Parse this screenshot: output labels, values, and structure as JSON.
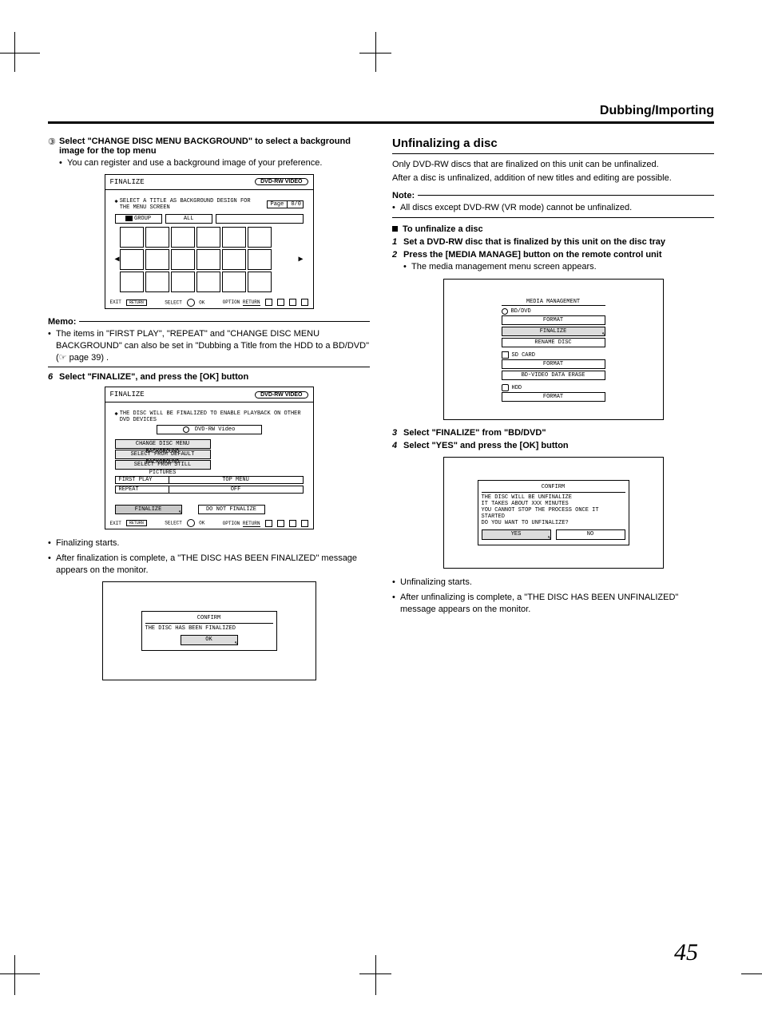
{
  "header": {
    "section": "Dubbing/Importing"
  },
  "page_number": "45",
  "left": {
    "step3": {
      "marker": "③",
      "title": "Select \"CHANGE DISC MENU BACKGROUND\" to select a background image for the top menu",
      "bullet": "You can register and use a background image of your preference."
    },
    "fig1": {
      "title": "FINALIZE",
      "badge": "DVD-RW VIDEO",
      "promptStar": "✱",
      "prompt": "SELECT A TITLE AS BACKGROUND DESIGN FOR THE MENU SCREEN",
      "page_label": "Page",
      "page_val": "0/0",
      "group": "GROUP",
      "all": "ALL",
      "foot_exit": "EXIT",
      "foot_back": "RETURN",
      "foot_select": "SELECT",
      "foot_ok": "OK",
      "foot_option": "OPTION",
      "foot_return": "RETURN"
    },
    "memo": {
      "label": "Memo:",
      "text": "The items in \"FIRST PLAY\", \"REPEAT\" and \"CHANGE DISC MENU BACKGROUND\" can also be set in \"Dubbing a Title from the HDD to a BD/DVD\" (☞ page 39) ."
    },
    "step6": {
      "marker": "6",
      "title": "Select \"FINALIZE\", and press the [OK] button"
    },
    "fig2": {
      "title": "FINALIZE",
      "badge": "DVD-RW VIDEO",
      "promptStar": "✱",
      "prompt": "THE DISC WILL BE FINALIZED TO ENABLE PLAYBACK ON OTHER DVD DEVICES",
      "dvd_label": "DVD-RW Video",
      "opt1": "CHANGE DISC MENU BACKGROUND",
      "opt2": "SELECT FROM DEFAULT BACKGROUND",
      "opt3": "SELECT FROM STILL PICTURES",
      "first_play_label": "FIRST PLAY",
      "first_play_val": "TOP MENU",
      "repeat_label": "REPEAT",
      "repeat_val": "OFF",
      "finalize": "FINALIZE",
      "do_not": "DO NOT FINALIZE"
    },
    "after": {
      "b1": "Finalizing starts.",
      "b2": "After finalization is complete, a \"THE DISC HAS BEEN FINALIZED\" message appears on the monitor."
    },
    "fig3": {
      "title": "CONFIRM",
      "msg": "THE DISC HAS BEEN FINALIZED",
      "ok": "OK"
    }
  },
  "right": {
    "heading": "Unfinalizing a disc",
    "p1": "Only DVD-RW discs that are finalized on this unit can be unfinalized.",
    "p2": "After a disc is unfinalized, addition of new titles and editing are possible.",
    "note_label": "Note:",
    "note_b1": "All discs except DVD-RW (VR mode) cannot be unfinalized.",
    "subheading": "To unfinalize a disc",
    "s1": {
      "n": "1",
      "t": "Set a DVD-RW disc that is finalized by this unit on the disc tray"
    },
    "s2": {
      "n": "2",
      "t": "Press the [MEDIA MANAGE] button on the remote control unit",
      "b": "The media management menu screen appears."
    },
    "figA": {
      "title": "MEDIA MANAGEMENT",
      "g1": "BD/DVD",
      "i1": "FORMAT",
      "i2": "FINALIZE",
      "i3": "RENAME DISC",
      "g2": "SD CARD",
      "i4": "FORMAT",
      "i5": "BD-VIDEO DATA ERASE",
      "g3": "HDD",
      "i6": "FORMAT"
    },
    "s3": {
      "n": "3",
      "t": "Select \"FINALIZE\" from \"BD/DVD\""
    },
    "s4": {
      "n": "4",
      "t": "Select \"YES\" and press the [OK] button"
    },
    "figB": {
      "title": "CONFIRM",
      "l1": "THE DISC WILL BE UNFINALIZE",
      "l2": "IT TAKES ABOUT XXX MINUTES",
      "l3": "YOU CANNOT STOP THE PROCESS ONCE IT STARTED",
      "l4": "DO YOU WANT TO UNFINALIZE?",
      "yes": "YES",
      "no": "NO"
    },
    "after": {
      "b1": "Unfinalizing starts.",
      "b2": "After unfinalizing is complete, a \"THE DISC HAS BEEN UNFINALIZED\" message appears on the monitor."
    }
  }
}
